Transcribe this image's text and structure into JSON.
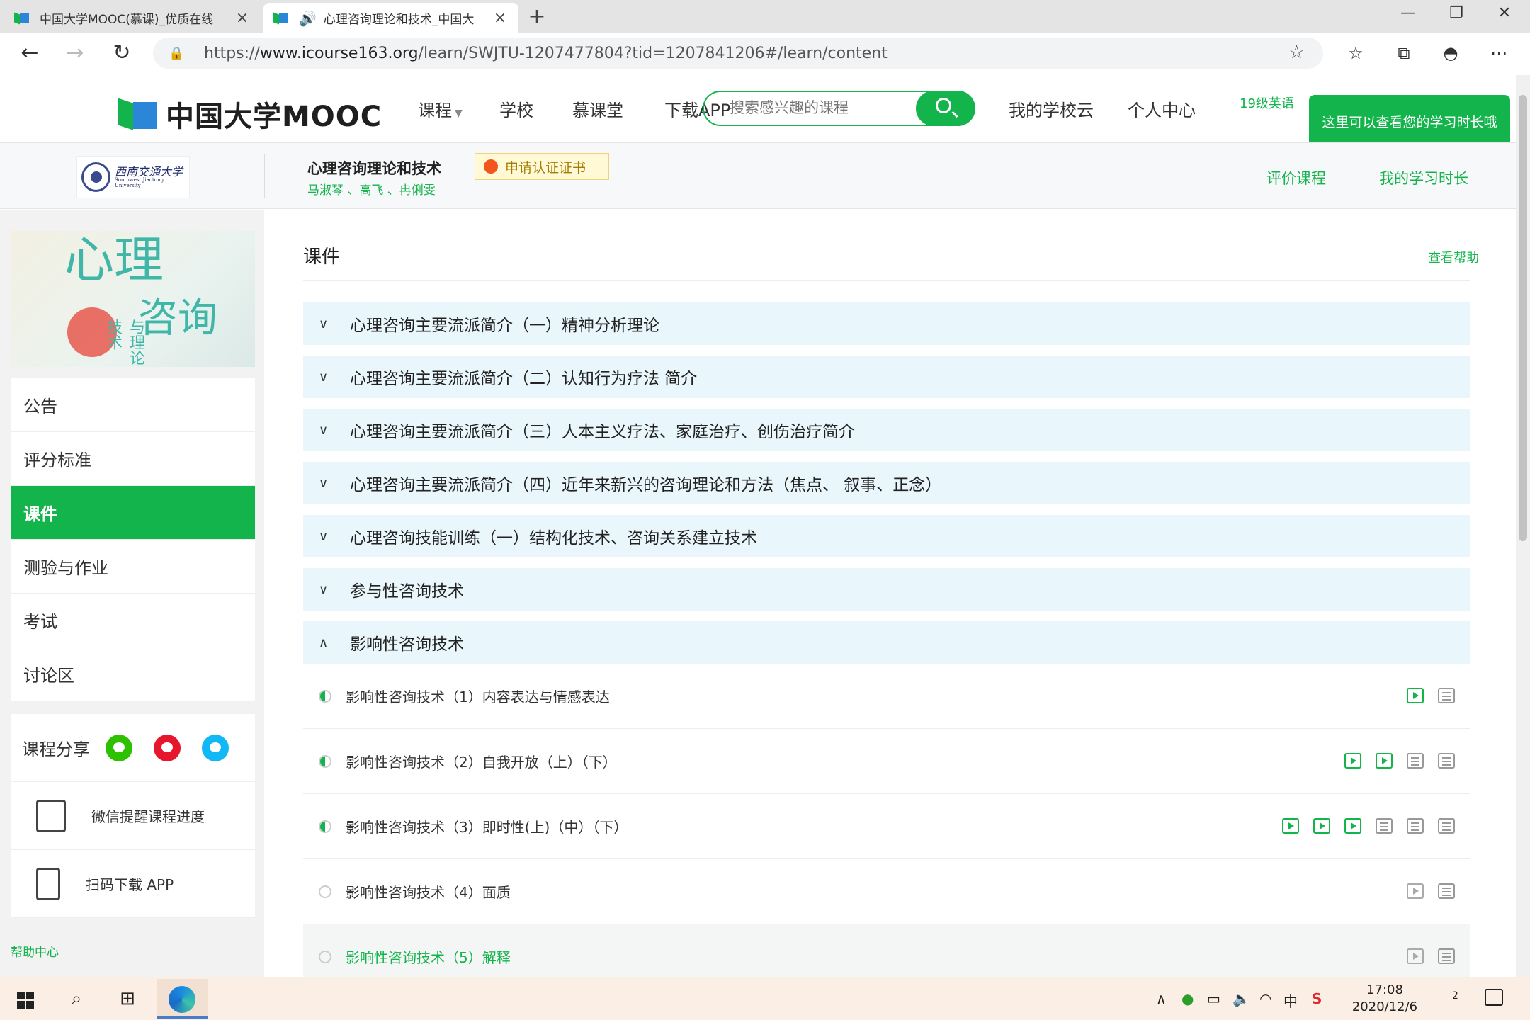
{
  "browser": {
    "tabs": [
      {
        "title": "中国大学MOOC(慕课)_优质在线",
        "active": false
      },
      {
        "title": "心理咨询理论和技术_中国大",
        "active": true
      }
    ],
    "url_prefix": "https://",
    "url_domain": "www.icourse163.org",
    "url_path": "/learn/SWJTU-1207477804?tid=1207841206#/learn/content"
  },
  "site": {
    "logo": "中国大学MOOC",
    "nav": [
      "课程",
      "学校",
      "慕课堂",
      "下载APP"
    ],
    "search_placeholder": "搜索感兴趣的课程",
    "right_nav": [
      "我的学校云",
      "个人中心"
    ],
    "broken_image_alt": "19级英语",
    "tooltip": "这里可以查看您的学习时长哦"
  },
  "course": {
    "school_name": "西南交通大学",
    "school_name_en": "Southwest Jiaotong University",
    "title": "心理咨询理论和技术",
    "teachers": "马淑琴 、高飞 、冉俐雯",
    "cert_button": "申请认证证书",
    "links": [
      "评价课程",
      "我的学习时长"
    ]
  },
  "sidebar": {
    "menu": [
      "公告",
      "评分标准",
      "课件",
      "测验与作业",
      "考试",
      "讨论区"
    ],
    "active_index": 2,
    "share_label": "课程分享",
    "tools": [
      "微信提醒课程进度",
      "扫码下载 APP"
    ],
    "help": "帮助中心"
  },
  "main": {
    "title": "课件",
    "help_link": "查看帮助",
    "chapters": [
      {
        "title": "心理咨询主要流派简介（一）精神分析理论",
        "expanded": false
      },
      {
        "title": "心理咨询主要流派简介（二）认知行为疗法 简介",
        "expanded": false
      },
      {
        "title": "心理咨询主要流派简介（三）人本主义疗法、家庭治疗、创伤治疗简介",
        "expanded": false
      },
      {
        "title": "心理咨询主要流派简介（四）近年来新兴的咨询理论和方法（焦点、 叙事、正念）",
        "expanded": false
      },
      {
        "title": "心理咨询技能训练（一）结构化技术、咨询关系建立技术",
        "expanded": false
      },
      {
        "title": "参与性咨询技术",
        "expanded": false
      },
      {
        "title": "影响性咨询技术",
        "expanded": true
      }
    ],
    "lessons": [
      {
        "title": "影响性咨询技术（1）内容表达与情感表达",
        "progress": "half",
        "icons": [
          "video",
          "doc"
        ]
      },
      {
        "title": "影响性咨询技术（2）自我开放（上）（下）",
        "progress": "half",
        "icons": [
          "video",
          "video",
          "doc",
          "doc"
        ]
      },
      {
        "title": "影响性咨询技术（3）即时性(上)（中）（下）",
        "progress": "half",
        "icons": [
          "video",
          "video",
          "video",
          "doc",
          "doc",
          "doc"
        ]
      },
      {
        "title": "影响性咨询技术（4）面质",
        "progress": "none",
        "icons": [
          "video-grey",
          "doc"
        ]
      },
      {
        "title": "影响性咨询技术（5）解释",
        "progress": "none",
        "icons": [
          "video-grey",
          "doc"
        ]
      }
    ]
  },
  "taskbar": {
    "ime": "中",
    "time": "17:08",
    "date": "2020/12/6",
    "notif_count": "2"
  }
}
